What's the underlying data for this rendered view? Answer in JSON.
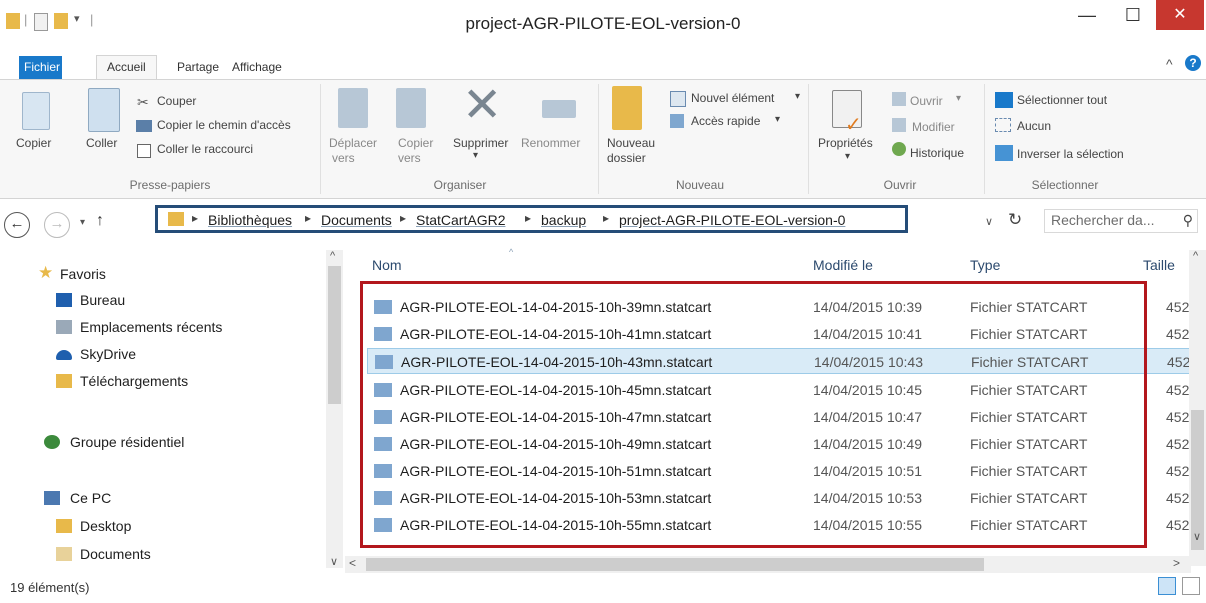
{
  "window": {
    "title": "project-AGR-PILOTE-EOL-version-0",
    "minimize": "—",
    "maximize": "☐",
    "close": "✕"
  },
  "tabs": [
    "Fichier",
    "Accueil",
    "Partage",
    "Affichage"
  ],
  "ribbon": {
    "presse_papiers": {
      "label": "Presse-papiers",
      "copier": "Copier",
      "coller": "Coller",
      "couper": "Couper",
      "copier_chemin": "Copier le chemin d'accès",
      "coller_raccourci": "Coller le raccourci"
    },
    "organiser": {
      "label": "Organiser",
      "deplacer": "Déplacer",
      "deplacer2": "vers",
      "copier": "Copier",
      "copier2": "vers",
      "supprimer": "Supprimer",
      "renommer": "Renommer"
    },
    "nouveau": {
      "label": "Nouveau",
      "nouveau_dossier": "Nouveau",
      "nouveau_dossier2": "dossier",
      "nouvel_element": "Nouvel élément",
      "acces_rapide": "Accès rapide"
    },
    "ouvrir": {
      "label": "Ouvrir",
      "proprietes": "Propriétés",
      "ouvrir": "Ouvrir",
      "modifier": "Modifier",
      "historique": "Historique"
    },
    "selectionner": {
      "label": "Sélectionner",
      "tout": "Sélectionner tout",
      "aucun": "Aucun",
      "inverser": "Inverser la sélection"
    }
  },
  "address": {
    "crumbs": [
      "Bibliothèques",
      "Documents",
      "StatCartAGR2",
      "backup",
      "project-AGR-PILOTE-EOL-version-0"
    ],
    "search_placeholder": "Rechercher da..."
  },
  "nav": {
    "favoris": "Favoris",
    "bureau": "Bureau",
    "recents": "Emplacements récents",
    "skydrive": "SkyDrive",
    "telechargements": "Téléchargements",
    "groupe": "Groupe résidentiel",
    "cepc": "Ce PC",
    "desktop": "Desktop",
    "documents": "Documents"
  },
  "columns": {
    "name": "Nom",
    "modified": "Modifié le",
    "type": "Type",
    "size": "Taille"
  },
  "files": [
    {
      "name": "AGR-PILOTE-EOL-14-04-2015-10h-39mn.statcart",
      "date": "14/04/2015 10:39",
      "type": "Fichier STATCART",
      "size": "452"
    },
    {
      "name": "AGR-PILOTE-EOL-14-04-2015-10h-41mn.statcart",
      "date": "14/04/2015 10:41",
      "type": "Fichier STATCART",
      "size": "452"
    },
    {
      "name": "AGR-PILOTE-EOL-14-04-2015-10h-43mn.statcart",
      "date": "14/04/2015 10:43",
      "type": "Fichier STATCART",
      "size": "452"
    },
    {
      "name": "AGR-PILOTE-EOL-14-04-2015-10h-45mn.statcart",
      "date": "14/04/2015 10:45",
      "type": "Fichier STATCART",
      "size": "452"
    },
    {
      "name": "AGR-PILOTE-EOL-14-04-2015-10h-47mn.statcart",
      "date": "14/04/2015 10:47",
      "type": "Fichier STATCART",
      "size": "452"
    },
    {
      "name": "AGR-PILOTE-EOL-14-04-2015-10h-49mn.statcart",
      "date": "14/04/2015 10:49",
      "type": "Fichier STATCART",
      "size": "452"
    },
    {
      "name": "AGR-PILOTE-EOL-14-04-2015-10h-51mn.statcart",
      "date": "14/04/2015 10:51",
      "type": "Fichier STATCART",
      "size": "452"
    },
    {
      "name": "AGR-PILOTE-EOL-14-04-2015-10h-53mn.statcart",
      "date": "14/04/2015 10:53",
      "type": "Fichier STATCART",
      "size": "452"
    },
    {
      "name": "AGR-PILOTE-EOL-14-04-2015-10h-55mn.statcart",
      "date": "14/04/2015 10:55",
      "type": "Fichier STATCART",
      "size": "452"
    }
  ],
  "status": "19 élément(s)",
  "colors": {
    "accent": "#1979ca",
    "address_border": "#254d78",
    "highlight_box": "#b3171d",
    "selected_row": "#d9ebf7"
  }
}
